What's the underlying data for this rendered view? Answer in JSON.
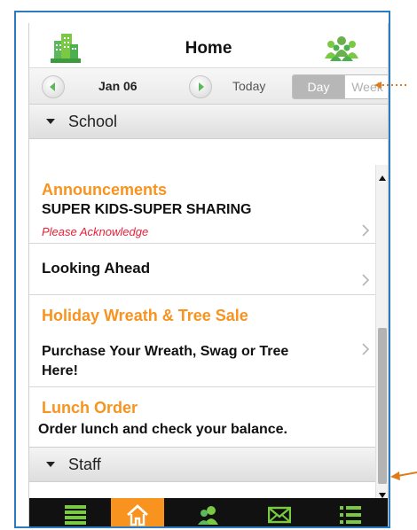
{
  "header": {
    "title": "Home",
    "left_icon": "building-icon",
    "right_icon": "people-group-icon"
  },
  "datebar": {
    "date": "Jan 06",
    "today": "Today",
    "view_options": [
      "Day",
      "Week"
    ],
    "selected_view": "Day"
  },
  "sections": {
    "school": "School",
    "staff": "Staff"
  },
  "school_items": [
    {
      "category": "Announcements",
      "title": "SUPER KIDS-SUPER SHARING",
      "status": "Please Acknowledge"
    },
    {
      "title": "Looking Ahead"
    },
    {
      "category": "Holiday Wreath & Tree Sale",
      "title_line1": "Purchase Your Wreath, Swag or Tree",
      "title_line2": "Here!"
    },
    {
      "category": "Lunch Order",
      "title": "Order lunch and check your balance."
    }
  ],
  "tabbar": {
    "tabs": [
      "list-icon",
      "home-icon",
      "contacts-icon",
      "mail-icon",
      "menu-icon"
    ],
    "active": "home-icon"
  },
  "colors": {
    "accent_orange": "#f7931e",
    "alert_red": "#e8203a",
    "frame_blue": "#2a7bc0",
    "brand_green": "#4caf50",
    "annotation_orange": "#e07b1a"
  }
}
